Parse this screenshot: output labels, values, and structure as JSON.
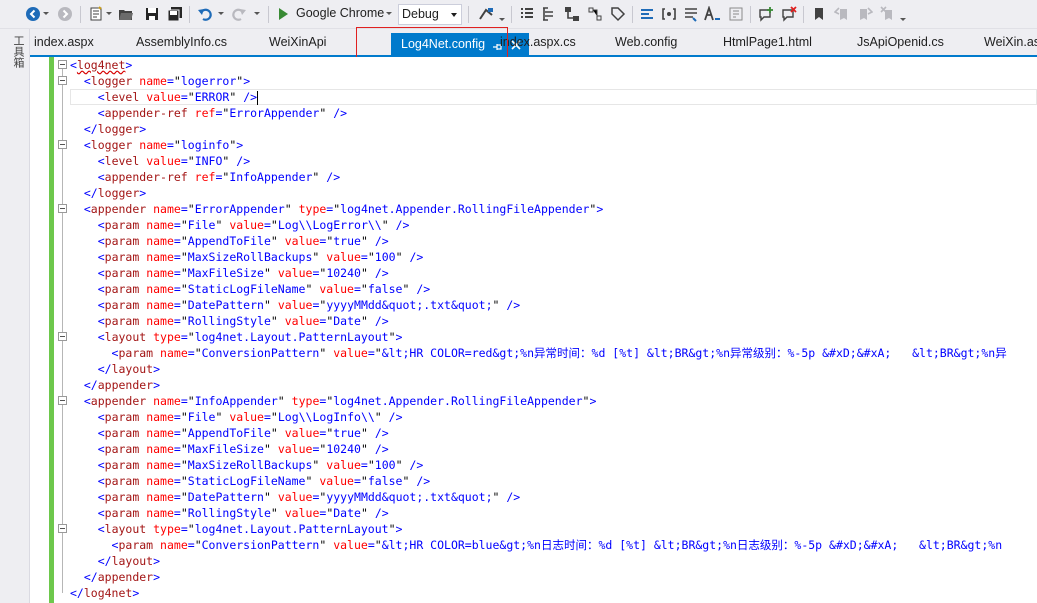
{
  "toolbar": {
    "run_label": "Google Chrome",
    "config_value": "Debug"
  },
  "toolbox": {
    "label": "工具箱"
  },
  "tabs": [
    {
      "label": "index.aspx"
    },
    {
      "label": "AssemblyInfo.cs"
    },
    {
      "label": "WeiXinApi"
    },
    {
      "label": "index.aspx.cs"
    },
    {
      "label": "Web.config"
    },
    {
      "label": "HtmlPage1.html"
    },
    {
      "label": "JsApiOpenid.cs"
    },
    {
      "label": "WeiXin.ash"
    }
  ],
  "active_tab": {
    "label": "Log4Net.config"
  },
  "colors": {
    "accent": "#007acc",
    "highlight_border": "#e02020",
    "change_bar": "#6dc84c"
  },
  "code_lines": [
    [
      [
        "br",
        "<"
      ],
      [
        "el",
        "log4net"
      ],
      [
        "br",
        ">"
      ]
    ],
    [
      [
        "t",
        "  "
      ],
      [
        "br",
        "<"
      ],
      [
        "el",
        "logger"
      ],
      [
        "t",
        " "
      ],
      [
        "at",
        "name"
      ],
      [
        "br",
        "="
      ],
      [
        "q",
        "\""
      ],
      [
        "v",
        "logerror"
      ],
      [
        "q",
        "\""
      ],
      [
        "br",
        ">"
      ]
    ],
    [
      [
        "t",
        "    "
      ],
      [
        "br",
        "<"
      ],
      [
        "el",
        "level"
      ],
      [
        "t",
        " "
      ],
      [
        "at",
        "value"
      ],
      [
        "br",
        "="
      ],
      [
        "q",
        "\""
      ],
      [
        "v",
        "ERROR"
      ],
      [
        "q",
        "\""
      ],
      [
        "t",
        " "
      ],
      [
        "br",
        "/>"
      ]
    ],
    [
      [
        "t",
        "    "
      ],
      [
        "br",
        "<"
      ],
      [
        "el",
        "appender-ref"
      ],
      [
        "t",
        " "
      ],
      [
        "at",
        "ref"
      ],
      [
        "br",
        "="
      ],
      [
        "q",
        "\""
      ],
      [
        "v",
        "ErrorAppender"
      ],
      [
        "q",
        "\""
      ],
      [
        "t",
        " "
      ],
      [
        "br",
        "/>"
      ]
    ],
    [
      [
        "t",
        "  "
      ],
      [
        "br",
        "</"
      ],
      [
        "el",
        "logger"
      ],
      [
        "br",
        ">"
      ]
    ],
    [
      [
        "t",
        "  "
      ],
      [
        "br",
        "<"
      ],
      [
        "el",
        "logger"
      ],
      [
        "t",
        " "
      ],
      [
        "at",
        "name"
      ],
      [
        "br",
        "="
      ],
      [
        "q",
        "\""
      ],
      [
        "v",
        "loginfo"
      ],
      [
        "q",
        "\""
      ],
      [
        "br",
        ">"
      ]
    ],
    [
      [
        "t",
        "    "
      ],
      [
        "br",
        "<"
      ],
      [
        "el",
        "level"
      ],
      [
        "t",
        " "
      ],
      [
        "at",
        "value"
      ],
      [
        "br",
        "="
      ],
      [
        "q",
        "\""
      ],
      [
        "v",
        "INFO"
      ],
      [
        "q",
        "\""
      ],
      [
        "t",
        " "
      ],
      [
        "br",
        "/>"
      ]
    ],
    [
      [
        "t",
        "    "
      ],
      [
        "br",
        "<"
      ],
      [
        "el",
        "appender-ref"
      ],
      [
        "t",
        " "
      ],
      [
        "at",
        "ref"
      ],
      [
        "br",
        "="
      ],
      [
        "q",
        "\""
      ],
      [
        "v",
        "InfoAppender"
      ],
      [
        "q",
        "\""
      ],
      [
        "t",
        " "
      ],
      [
        "br",
        "/>"
      ]
    ],
    [
      [
        "t",
        "  "
      ],
      [
        "br",
        "</"
      ],
      [
        "el",
        "logger"
      ],
      [
        "br",
        ">"
      ]
    ],
    [
      [
        "t",
        "  "
      ],
      [
        "br",
        "<"
      ],
      [
        "el",
        "appender"
      ],
      [
        "t",
        " "
      ],
      [
        "at",
        "name"
      ],
      [
        "br",
        "="
      ],
      [
        "q",
        "\""
      ],
      [
        "v",
        "ErrorAppender"
      ],
      [
        "q",
        "\""
      ],
      [
        "t",
        " "
      ],
      [
        "at",
        "type"
      ],
      [
        "br",
        "="
      ],
      [
        "q",
        "\""
      ],
      [
        "v",
        "log4net.Appender.RollingFileAppender"
      ],
      [
        "q",
        "\""
      ],
      [
        "br",
        ">"
      ]
    ],
    [
      [
        "t",
        "    "
      ],
      [
        "br",
        "<"
      ],
      [
        "el",
        "param"
      ],
      [
        "t",
        " "
      ],
      [
        "at",
        "name"
      ],
      [
        "br",
        "="
      ],
      [
        "q",
        "\""
      ],
      [
        "v",
        "File"
      ],
      [
        "q",
        "\""
      ],
      [
        "t",
        " "
      ],
      [
        "at",
        "value"
      ],
      [
        "br",
        "="
      ],
      [
        "q",
        "\""
      ],
      [
        "v",
        "Log\\\\LogError\\\\"
      ],
      [
        "q",
        "\""
      ],
      [
        "t",
        " "
      ],
      [
        "br",
        "/>"
      ]
    ],
    [
      [
        "t",
        "    "
      ],
      [
        "br",
        "<"
      ],
      [
        "el",
        "param"
      ],
      [
        "t",
        " "
      ],
      [
        "at",
        "name"
      ],
      [
        "br",
        "="
      ],
      [
        "q",
        "\""
      ],
      [
        "v",
        "AppendToFile"
      ],
      [
        "q",
        "\""
      ],
      [
        "t",
        " "
      ],
      [
        "at",
        "value"
      ],
      [
        "br",
        "="
      ],
      [
        "q",
        "\""
      ],
      [
        "v",
        "true"
      ],
      [
        "q",
        "\""
      ],
      [
        "t",
        " "
      ],
      [
        "br",
        "/>"
      ]
    ],
    [
      [
        "t",
        "    "
      ],
      [
        "br",
        "<"
      ],
      [
        "el",
        "param"
      ],
      [
        "t",
        " "
      ],
      [
        "at",
        "name"
      ],
      [
        "br",
        "="
      ],
      [
        "q",
        "\""
      ],
      [
        "v",
        "MaxSizeRollBackups"
      ],
      [
        "q",
        "\""
      ],
      [
        "t",
        " "
      ],
      [
        "at",
        "value"
      ],
      [
        "br",
        "="
      ],
      [
        "q",
        "\""
      ],
      [
        "v",
        "100"
      ],
      [
        "q",
        "\""
      ],
      [
        "t",
        " "
      ],
      [
        "br",
        "/>"
      ]
    ],
    [
      [
        "t",
        "    "
      ],
      [
        "br",
        "<"
      ],
      [
        "el",
        "param"
      ],
      [
        "t",
        " "
      ],
      [
        "at",
        "name"
      ],
      [
        "br",
        "="
      ],
      [
        "q",
        "\""
      ],
      [
        "v",
        "MaxFileSize"
      ],
      [
        "q",
        "\""
      ],
      [
        "t",
        " "
      ],
      [
        "at",
        "value"
      ],
      [
        "br",
        "="
      ],
      [
        "q",
        "\""
      ],
      [
        "v",
        "10240"
      ],
      [
        "q",
        "\""
      ],
      [
        "t",
        " "
      ],
      [
        "br",
        "/>"
      ]
    ],
    [
      [
        "t",
        "    "
      ],
      [
        "br",
        "<"
      ],
      [
        "el",
        "param"
      ],
      [
        "t",
        " "
      ],
      [
        "at",
        "name"
      ],
      [
        "br",
        "="
      ],
      [
        "q",
        "\""
      ],
      [
        "v",
        "StaticLogFileName"
      ],
      [
        "q",
        "\""
      ],
      [
        "t",
        " "
      ],
      [
        "at",
        "value"
      ],
      [
        "br",
        "="
      ],
      [
        "q",
        "\""
      ],
      [
        "v",
        "false"
      ],
      [
        "q",
        "\""
      ],
      [
        "t",
        " "
      ],
      [
        "br",
        "/>"
      ]
    ],
    [
      [
        "t",
        "    "
      ],
      [
        "br",
        "<"
      ],
      [
        "el",
        "param"
      ],
      [
        "t",
        " "
      ],
      [
        "at",
        "name"
      ],
      [
        "br",
        "="
      ],
      [
        "q",
        "\""
      ],
      [
        "v",
        "DatePattern"
      ],
      [
        "q",
        "\""
      ],
      [
        "t",
        " "
      ],
      [
        "at",
        "value"
      ],
      [
        "br",
        "="
      ],
      [
        "q",
        "\""
      ],
      [
        "v",
        "yyyyMMdd&quot;.txt&quot;"
      ],
      [
        "q",
        "\""
      ],
      [
        "t",
        " "
      ],
      [
        "br",
        "/>"
      ]
    ],
    [
      [
        "t",
        "    "
      ],
      [
        "br",
        "<"
      ],
      [
        "el",
        "param"
      ],
      [
        "t",
        " "
      ],
      [
        "at",
        "name"
      ],
      [
        "br",
        "="
      ],
      [
        "q",
        "\""
      ],
      [
        "v",
        "RollingStyle"
      ],
      [
        "q",
        "\""
      ],
      [
        "t",
        " "
      ],
      [
        "at",
        "value"
      ],
      [
        "br",
        "="
      ],
      [
        "q",
        "\""
      ],
      [
        "v",
        "Date"
      ],
      [
        "q",
        "\""
      ],
      [
        "t",
        " "
      ],
      [
        "br",
        "/>"
      ]
    ],
    [
      [
        "t",
        "    "
      ],
      [
        "br",
        "<"
      ],
      [
        "el",
        "layout"
      ],
      [
        "t",
        " "
      ],
      [
        "at",
        "type"
      ],
      [
        "br",
        "="
      ],
      [
        "q",
        "\""
      ],
      [
        "v",
        "log4net.Layout.PatternLayout"
      ],
      [
        "q",
        "\""
      ],
      [
        "br",
        ">"
      ]
    ],
    [
      [
        "t",
        "      "
      ],
      [
        "br",
        "<"
      ],
      [
        "el",
        "param"
      ],
      [
        "t",
        " "
      ],
      [
        "at",
        "name"
      ],
      [
        "br",
        "="
      ],
      [
        "q",
        "\""
      ],
      [
        "v",
        "ConversionPattern"
      ],
      [
        "q",
        "\""
      ],
      [
        "t",
        " "
      ],
      [
        "at",
        "value"
      ],
      [
        "br",
        "="
      ],
      [
        "q",
        "\""
      ],
      [
        "v",
        "&lt;HR COLOR=red&gt;%n异常时间：%d [%t] &lt;BR&gt;%n异常级别：%-5p &#xD;&#xA;   &lt;BR&gt;%n异"
      ]
    ],
    [
      [
        "t",
        "    "
      ],
      [
        "br",
        "</"
      ],
      [
        "el",
        "layout"
      ],
      [
        "br",
        ">"
      ]
    ],
    [
      [
        "t",
        "  "
      ],
      [
        "br",
        "</"
      ],
      [
        "el",
        "appender"
      ],
      [
        "br",
        ">"
      ]
    ],
    [
      [
        "t",
        "  "
      ],
      [
        "br",
        "<"
      ],
      [
        "el",
        "appender"
      ],
      [
        "t",
        " "
      ],
      [
        "at",
        "name"
      ],
      [
        "br",
        "="
      ],
      [
        "q",
        "\""
      ],
      [
        "v",
        "InfoAppender"
      ],
      [
        "q",
        "\""
      ],
      [
        "t",
        " "
      ],
      [
        "at",
        "type"
      ],
      [
        "br",
        "="
      ],
      [
        "q",
        "\""
      ],
      [
        "v",
        "log4net.Appender.RollingFileAppender"
      ],
      [
        "q",
        "\""
      ],
      [
        "br",
        ">"
      ]
    ],
    [
      [
        "t",
        "    "
      ],
      [
        "br",
        "<"
      ],
      [
        "el",
        "param"
      ],
      [
        "t",
        " "
      ],
      [
        "at",
        "name"
      ],
      [
        "br",
        "="
      ],
      [
        "q",
        "\""
      ],
      [
        "v",
        "File"
      ],
      [
        "q",
        "\""
      ],
      [
        "t",
        " "
      ],
      [
        "at",
        "value"
      ],
      [
        "br",
        "="
      ],
      [
        "q",
        "\""
      ],
      [
        "v",
        "Log\\\\LogInfo\\\\"
      ],
      [
        "q",
        "\""
      ],
      [
        "t",
        " "
      ],
      [
        "br",
        "/>"
      ]
    ],
    [
      [
        "t",
        "    "
      ],
      [
        "br",
        "<"
      ],
      [
        "el",
        "param"
      ],
      [
        "t",
        " "
      ],
      [
        "at",
        "name"
      ],
      [
        "br",
        "="
      ],
      [
        "q",
        "\""
      ],
      [
        "v",
        "AppendToFile"
      ],
      [
        "q",
        "\""
      ],
      [
        "t",
        " "
      ],
      [
        "at",
        "value"
      ],
      [
        "br",
        "="
      ],
      [
        "q",
        "\""
      ],
      [
        "v",
        "true"
      ],
      [
        "q",
        "\""
      ],
      [
        "t",
        " "
      ],
      [
        "br",
        "/>"
      ]
    ],
    [
      [
        "t",
        "    "
      ],
      [
        "br",
        "<"
      ],
      [
        "el",
        "param"
      ],
      [
        "t",
        " "
      ],
      [
        "at",
        "name"
      ],
      [
        "br",
        "="
      ],
      [
        "q",
        "\""
      ],
      [
        "v",
        "MaxFileSize"
      ],
      [
        "q",
        "\""
      ],
      [
        "t",
        " "
      ],
      [
        "at",
        "value"
      ],
      [
        "br",
        "="
      ],
      [
        "q",
        "\""
      ],
      [
        "v",
        "10240"
      ],
      [
        "q",
        "\""
      ],
      [
        "t",
        " "
      ],
      [
        "br",
        "/>"
      ]
    ],
    [
      [
        "t",
        "    "
      ],
      [
        "br",
        "<"
      ],
      [
        "el",
        "param"
      ],
      [
        "t",
        " "
      ],
      [
        "at",
        "name"
      ],
      [
        "br",
        "="
      ],
      [
        "q",
        "\""
      ],
      [
        "v",
        "MaxSizeRollBackups"
      ],
      [
        "q",
        "\""
      ],
      [
        "t",
        " "
      ],
      [
        "at",
        "value"
      ],
      [
        "br",
        "="
      ],
      [
        "q",
        "\""
      ],
      [
        "v",
        "100"
      ],
      [
        "q",
        "\""
      ],
      [
        "t",
        " "
      ],
      [
        "br",
        "/>"
      ]
    ],
    [
      [
        "t",
        "    "
      ],
      [
        "br",
        "<"
      ],
      [
        "el",
        "param"
      ],
      [
        "t",
        " "
      ],
      [
        "at",
        "name"
      ],
      [
        "br",
        "="
      ],
      [
        "q",
        "\""
      ],
      [
        "v",
        "StaticLogFileName"
      ],
      [
        "q",
        "\""
      ],
      [
        "t",
        " "
      ],
      [
        "at",
        "value"
      ],
      [
        "br",
        "="
      ],
      [
        "q",
        "\""
      ],
      [
        "v",
        "false"
      ],
      [
        "q",
        "\""
      ],
      [
        "t",
        " "
      ],
      [
        "br",
        "/>"
      ]
    ],
    [
      [
        "t",
        "    "
      ],
      [
        "br",
        "<"
      ],
      [
        "el",
        "param"
      ],
      [
        "t",
        " "
      ],
      [
        "at",
        "name"
      ],
      [
        "br",
        "="
      ],
      [
        "q",
        "\""
      ],
      [
        "v",
        "DatePattern"
      ],
      [
        "q",
        "\""
      ],
      [
        "t",
        " "
      ],
      [
        "at",
        "value"
      ],
      [
        "br",
        "="
      ],
      [
        "q",
        "\""
      ],
      [
        "v",
        "yyyyMMdd&quot;.txt&quot;"
      ],
      [
        "q",
        "\""
      ],
      [
        "t",
        " "
      ],
      [
        "br",
        "/>"
      ]
    ],
    [
      [
        "t",
        "    "
      ],
      [
        "br",
        "<"
      ],
      [
        "el",
        "param"
      ],
      [
        "t",
        " "
      ],
      [
        "at",
        "name"
      ],
      [
        "br",
        "="
      ],
      [
        "q",
        "\""
      ],
      [
        "v",
        "RollingStyle"
      ],
      [
        "q",
        "\""
      ],
      [
        "t",
        " "
      ],
      [
        "at",
        "value"
      ],
      [
        "br",
        "="
      ],
      [
        "q",
        "\""
      ],
      [
        "v",
        "Date"
      ],
      [
        "q",
        "\""
      ],
      [
        "t",
        " "
      ],
      [
        "br",
        "/>"
      ]
    ],
    [
      [
        "t",
        "    "
      ],
      [
        "br",
        "<"
      ],
      [
        "el",
        "layout"
      ],
      [
        "t",
        " "
      ],
      [
        "at",
        "type"
      ],
      [
        "br",
        "="
      ],
      [
        "q",
        "\""
      ],
      [
        "v",
        "log4net.Layout.PatternLayout"
      ],
      [
        "q",
        "\""
      ],
      [
        "br",
        ">"
      ]
    ],
    [
      [
        "t",
        "      "
      ],
      [
        "br",
        "<"
      ],
      [
        "el",
        "param"
      ],
      [
        "t",
        " "
      ],
      [
        "at",
        "name"
      ],
      [
        "br",
        "="
      ],
      [
        "q",
        "\""
      ],
      [
        "v",
        "ConversionPattern"
      ],
      [
        "q",
        "\""
      ],
      [
        "t",
        " "
      ],
      [
        "at",
        "value"
      ],
      [
        "br",
        "="
      ],
      [
        "q",
        "\""
      ],
      [
        "v",
        "&lt;HR COLOR=blue&gt;%n日志时间：%d [%t] &lt;BR&gt;%n日志级别：%-5p &#xD;&#xA;   &lt;BR&gt;%n"
      ]
    ],
    [
      [
        "t",
        "    "
      ],
      [
        "br",
        "</"
      ],
      [
        "el",
        "layout"
      ],
      [
        "br",
        ">"
      ]
    ],
    [
      [
        "t",
        "  "
      ],
      [
        "br",
        "</"
      ],
      [
        "el",
        "appender"
      ],
      [
        "br",
        ">"
      ]
    ],
    [
      [
        "br",
        "</"
      ],
      [
        "el",
        "log4net"
      ],
      [
        "br",
        ">"
      ]
    ]
  ]
}
